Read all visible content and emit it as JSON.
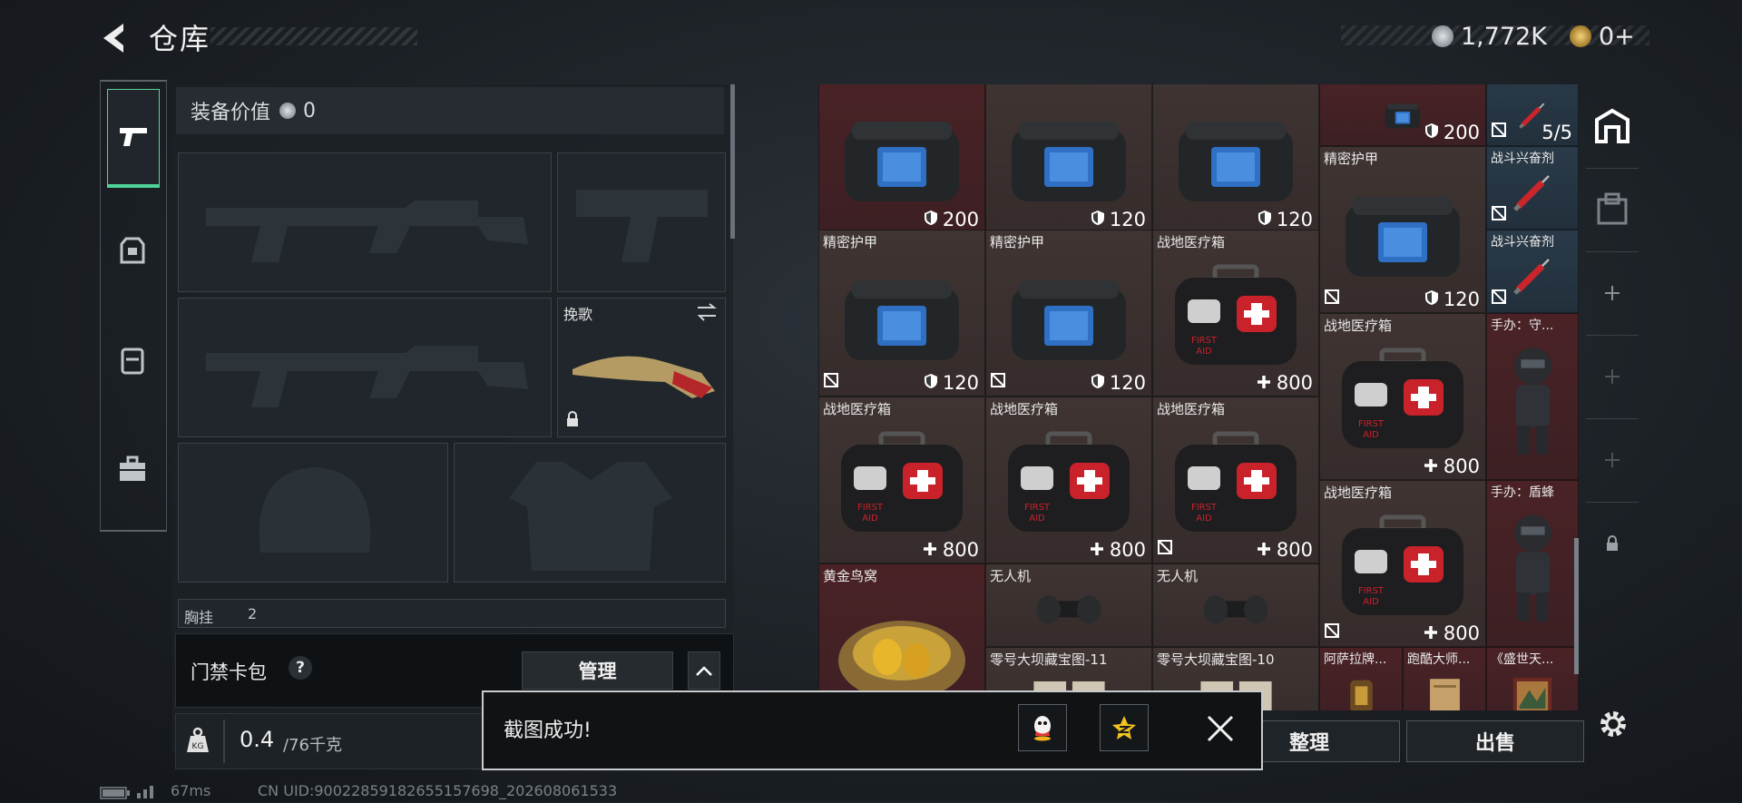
{
  "header": {
    "title": "仓库",
    "currency_1": "1,772K",
    "currency_2": "0+"
  },
  "equipment": {
    "value_label": "装备价值",
    "value": "0",
    "knife_label": "挽歌",
    "chest_label": "胸挂",
    "chest_count": "2",
    "card_pack_label": "门禁卡包",
    "card_pack_help": "?",
    "manage_label": "管理",
    "weight_current": "0.4",
    "weight_max": "/76千克"
  },
  "storage": {
    "cells": [
      {
        "name": "",
        "value": "200",
        "stat": "shield",
        "tint": "red",
        "item": "backpack-icon",
        "flag": false
      },
      {
        "name": "",
        "value": "120",
        "stat": "shield",
        "tint": "brown",
        "item": "backpack-icon",
        "flag": false
      },
      {
        "name": "",
        "value": "120",
        "stat": "shield",
        "tint": "brown",
        "item": "backpack-icon",
        "flag": false
      },
      {
        "name": "",
        "value": "200",
        "stat": "shield",
        "tint": "red",
        "item": "backpack-icon",
        "flag": false
      },
      {
        "name": "",
        "value": "5/5",
        "stat": "none",
        "tint": "blue",
        "item": "syringe-icon",
        "flag": true
      },
      {
        "name": "精密护甲",
        "value": "120",
        "stat": "shield",
        "tint": "brown",
        "item": "backpack-icon",
        "flag": true
      },
      {
        "name": "战斗兴奋剂",
        "value": "",
        "stat": "none",
        "tint": "blue",
        "item": "syringe-icon",
        "flag": true
      },
      {
        "name": "战斗兴奋剂",
        "value": "",
        "stat": "none",
        "tint": "blue",
        "item": "syringe-icon",
        "flag": true
      },
      {
        "name": "精密护甲",
        "value": "120",
        "stat": "shield",
        "tint": "brown",
        "item": "backpack-icon",
        "flag": true
      },
      {
        "name": "精密护甲",
        "value": "120",
        "stat": "shield",
        "tint": "brown",
        "item": "backpack-icon",
        "flag": true
      },
      {
        "name": "战地医疗箱",
        "value": "800",
        "stat": "plus",
        "tint": "brown",
        "item": "medkit-icon",
        "flag": false
      },
      {
        "name": "战地医疗箱",
        "value": "800",
        "stat": "plus",
        "tint": "brown",
        "item": "medkit-icon",
        "flag": false
      },
      {
        "name": "手办：守...",
        "value": "",
        "stat": "none",
        "tint": "red",
        "item": "figurine-icon",
        "flag": false
      },
      {
        "name": "战地医疗箱",
        "value": "800",
        "stat": "plus",
        "tint": "brown",
        "item": "medkit-icon",
        "flag": false
      },
      {
        "name": "战地医疗箱",
        "value": "800",
        "stat": "plus",
        "tint": "brown",
        "item": "medkit-icon",
        "flag": false
      },
      {
        "name": "战地医疗箱",
        "value": "800",
        "stat": "plus",
        "tint": "brown",
        "item": "medkit-icon",
        "flag": true
      },
      {
        "name": "战地医疗箱",
        "value": "800",
        "stat": "plus",
        "tint": "brown",
        "item": "medkit-icon",
        "flag": true
      },
      {
        "name": "手办：盾蜂",
        "value": "",
        "stat": "none",
        "tint": "red",
        "item": "figurine-icon",
        "flag": false
      },
      {
        "name": "黄金鸟窝",
        "value": "",
        "stat": "none",
        "tint": "red",
        "item": "golden-nest-icon",
        "flag": false
      },
      {
        "name": "无人机",
        "value": "",
        "stat": "none",
        "tint": "brown",
        "item": "drone-icon",
        "flag": false
      },
      {
        "name": "无人机",
        "value": "",
        "stat": "none",
        "tint": "brown",
        "item": "drone-icon",
        "flag": false
      },
      {
        "name": "零号大坝藏宝图-11",
        "value": "",
        "stat": "none",
        "tint": "brown",
        "item": "map-icon",
        "flag": false
      },
      {
        "name": "零号大坝藏宝图-10",
        "value": "",
        "stat": "none",
        "tint": "brown",
        "item": "map-icon",
        "flag": false
      },
      {
        "name": "阿萨拉牌...",
        "value": "",
        "stat": "none",
        "tint": "red",
        "item": "artifact-icon",
        "flag": false
      },
      {
        "name": "跑酷大师...",
        "value": "",
        "stat": "none",
        "tint": "red",
        "item": "scroll-icon",
        "flag": false
      },
      {
        "name": "《盛世天...",
        "value": "",
        "stat": "none",
        "tint": "red",
        "item": "painting-icon",
        "flag": false
      }
    ],
    "sort_label": "整理",
    "sell_label": "出售"
  },
  "toast": {
    "message": "截图成功!"
  },
  "status": {
    "ping": "67ms",
    "uid": "CN UID:90022859182655157698_202608061533"
  },
  "colors": {
    "accent_green": "#4fd39a",
    "cell_red": "#4a2226",
    "cell_brown": "#3f3432",
    "cell_blue": "#2a3a48"
  }
}
